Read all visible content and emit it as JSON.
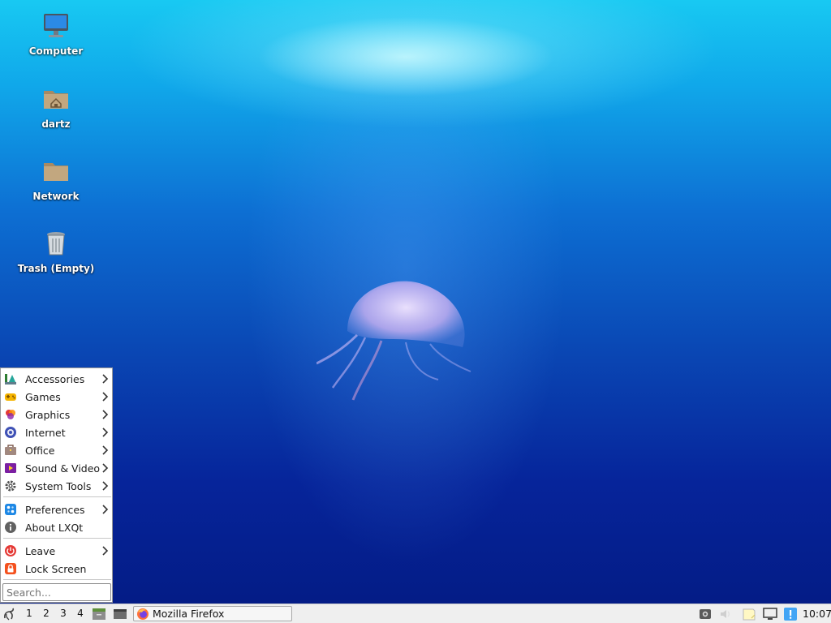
{
  "desktop": {
    "icons": [
      {
        "label": "Computer",
        "icon": "computer-icon"
      },
      {
        "label": "dartz",
        "icon": "home-folder-icon"
      },
      {
        "label": "Network",
        "icon": "network-folder-icon"
      },
      {
        "label": "Trash (Empty)",
        "icon": "trash-icon"
      }
    ]
  },
  "start_menu": {
    "items": [
      {
        "label": "Accessories",
        "icon": "accessories-icon",
        "has_submenu": true
      },
      {
        "label": "Games",
        "icon": "games-icon",
        "has_submenu": true
      },
      {
        "label": "Graphics",
        "icon": "graphics-icon",
        "has_submenu": true
      },
      {
        "label": "Internet",
        "icon": "internet-icon",
        "has_submenu": true
      },
      {
        "label": "Office",
        "icon": "office-icon",
        "has_submenu": true
      },
      {
        "label": "Sound & Video",
        "icon": "sound-video-icon",
        "has_submenu": true
      },
      {
        "label": "System Tools",
        "icon": "system-tools-icon",
        "has_submenu": true
      },
      {
        "label": "Preferences",
        "icon": "preferences-icon",
        "has_submenu": true
      },
      {
        "label": "About LXQt",
        "icon": "info-icon",
        "has_submenu": false
      },
      {
        "label": "Leave",
        "icon": "power-icon",
        "has_submenu": true
      },
      {
        "label": "Lock Screen",
        "icon": "lock-icon",
        "has_submenu": false
      }
    ],
    "search_placeholder": "Search..."
  },
  "taskbar": {
    "workspaces": [
      "1",
      "2",
      "3",
      "4"
    ],
    "task": {
      "label": "Mozilla Firefox",
      "icon": "firefox-icon"
    },
    "clock": "10:07"
  },
  "colors": {
    "menu_bg": "#ffffff",
    "taskbar_bg": "#efefef",
    "wallpaper_top": "#18c9f2",
    "wallpaper_bottom": "#041c86"
  }
}
